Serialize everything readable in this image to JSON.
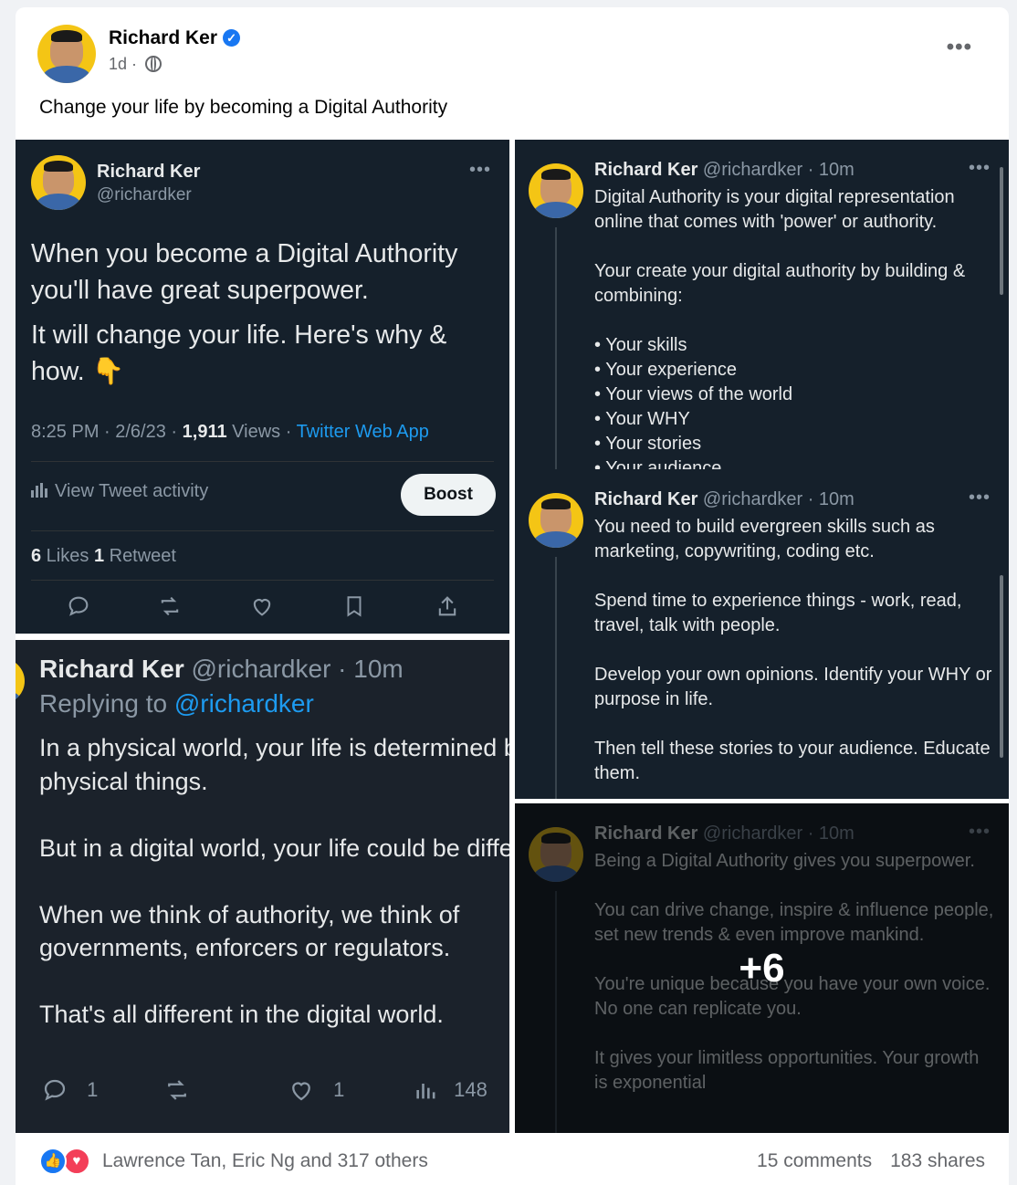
{
  "post": {
    "author": "Richard Ker",
    "time": "1d",
    "separator": "·",
    "text": "Change your life by becoming a Digital Authority",
    "more": "•••"
  },
  "tweet1": {
    "name": "Richard Ker",
    "handle": "@richardker",
    "dots": "•••",
    "p1": "When you become a Digital Authority you'll have great superpower.",
    "p2": "It will change your life. Here's why & how. 👇",
    "time": "8:25 PM · 2/6/23 · ",
    "views_count": "1,911",
    "views_label": " Views · ",
    "source": "Twitter Web App",
    "activity": "View Tweet activity",
    "boost": "Boost",
    "likes_count": "6",
    "likes_label": " Likes  ",
    "retweets_count": "1",
    "retweets_label": " Retweet"
  },
  "tweet2": {
    "name": "Richard Ker",
    "handle_time": " @richardker · 10m",
    "replying": "Replying to ",
    "reply_handle": "@richardker",
    "body": "In a physical world, your life is determined by the physical things.\n\nBut in a digital world, your life could be different.\n\nWhen we think of authority, we think of governments, enforcers or regulators.\n\nThat's all different in the digital world.",
    "replies": "1",
    "likes": "1",
    "views": "148"
  },
  "thread": [
    {
      "name": "Richard Ker",
      "meta": " @richardker · 10m",
      "body": "Digital Authority is your digital representation online that comes with 'power' or authority.\n\nYour create your digital authority by building & combining:\n\n• Your skills\n• Your experience\n• Your views of the world\n• Your WHY\n• Your stories\n• Your audience"
    },
    {
      "name": "Richard Ker",
      "meta": " @richardker · 10m",
      "body": "You need to build evergreen skills such as marketing, copywriting, coding etc.\n\nSpend time to experience things - work, read, travel, talk with people.\n\nDevelop your own opinions. Identify your WHY or purpose in life.\n\nThen tell these stories to your audience. Educate them."
    },
    {
      "name": "Richard Ker",
      "meta": " @richardker · 10m",
      "body": "Being a Digital Authority gives you superpower.\n\nYou can drive change, inspire & influence people, set new trends & even improve mankind.\n\nYou're unique because you have your own voice. No one can replicate you.\n\nIt gives your limitless opportunities. Your growth is exponential"
    }
  ],
  "more_photos": "+6",
  "footer": {
    "reactors": "Lawrence Tan, Eric Ng and 317 others",
    "comments": "15 comments",
    "shares": "183 shares"
  }
}
